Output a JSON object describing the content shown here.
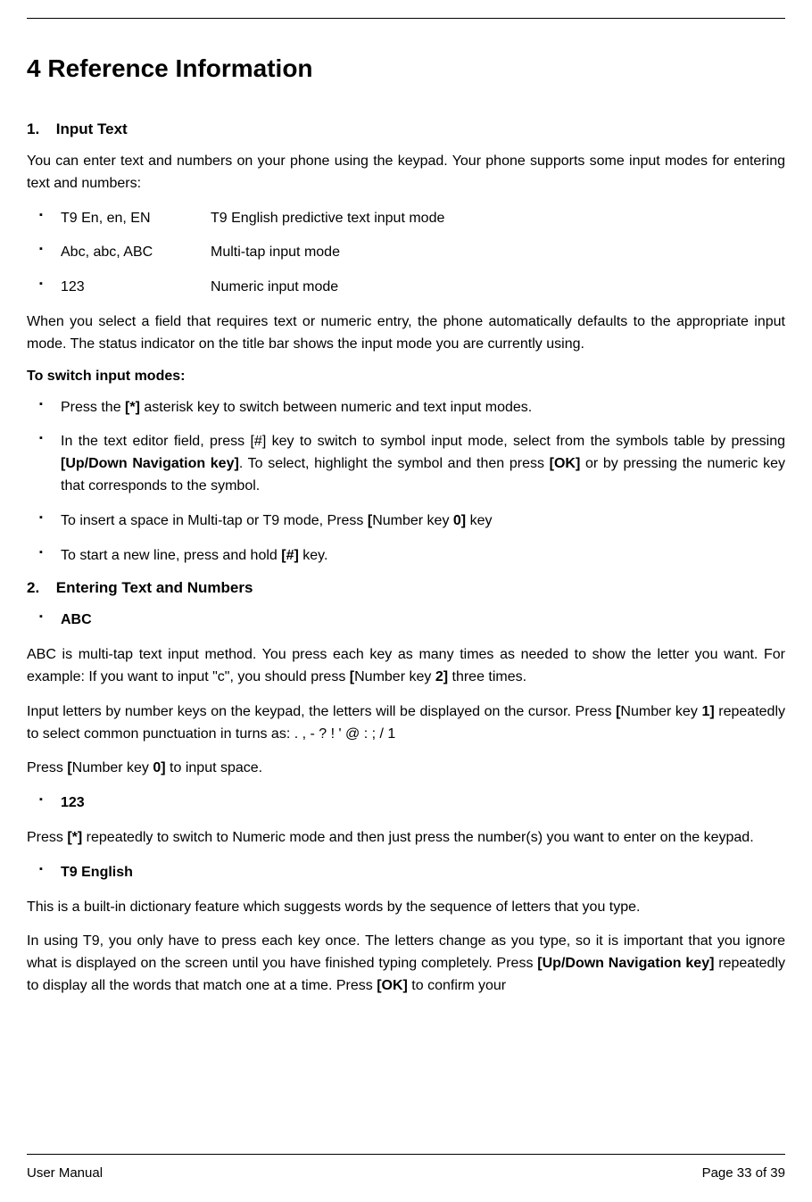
{
  "title": "4 Reference Information",
  "section1": {
    "num": "1.",
    "title": "Input Text",
    "intro": "You can enter text and numbers on your phone using the keypad. Your phone supports some input modes for entering text and numbers:",
    "modes": [
      {
        "name": "T9 En, en, EN",
        "desc": "T9 English predictive text input mode"
      },
      {
        "name": "Abc, abc, ABC",
        "desc": "Multi-tap input mode"
      },
      {
        "name": "123",
        "desc": "Numeric input mode"
      }
    ],
    "after_modes": "When you select a field that requires text or numeric entry, the phone automatically defaults to the appropriate input mode. The status indicator on the title bar shows the input mode you are currently using.",
    "switch_heading": "To switch input modes:",
    "switch": {
      "item1_a": "Press the ",
      "item1_b": "[*]",
      "item1_c": " asterisk key to switch between numeric and text input modes.",
      "item2_a": "In the text editor field, press [#] key to switch to symbol input mode, select from the symbols table by pressing ",
      "item2_b": "[Up/Down Navigation key]",
      "item2_c": ". To select, highlight the symbol and then press ",
      "item2_d": "[OK]",
      "item2_e": " or by pressing the numeric key that corresponds to the symbol.",
      "item3_a": "To insert a space in Multi-tap or T9 mode, Press ",
      "item3_b": "[",
      "item3_c": "Number key ",
      "item3_d": "0]",
      "item3_e": " key",
      "item4_a": "To start a new line, press and hold ",
      "item4_b": "[#]",
      "item4_c": " key."
    }
  },
  "section2": {
    "num": "2.",
    "title": "Entering Text and Numbers",
    "abc_label": "ABC",
    "abc_p1_a": "ABC is multi-tap text input method. You press each key as many times as needed to show the letter you want. For example: If you want to input \"c\", you should press ",
    "abc_p1_b": "[",
    "abc_p1_c": "Number key ",
    "abc_p1_d": "2]",
    "abc_p1_e": " three times.",
    "abc_p2_a": "Input letters by number keys on the keypad, the letters will be displayed on the cursor. Press ",
    "abc_p2_b": "[",
    "abc_p2_c": "Number key ",
    "abc_p2_d": "1]",
    "abc_p2_e": " repeatedly to select common punctuation in turns as: . , - ? ! ' @ : ; / 1",
    "abc_p3_a": "Press ",
    "abc_p3_b": "[",
    "abc_p3_c": "Number key ",
    "abc_p3_d": "0]",
    "abc_p3_e": " to input space.",
    "n123_label": "123",
    "n123_p_a": "Press ",
    "n123_p_b": "[*]",
    "n123_p_c": " repeatedly to switch to Numeric mode and then just press the number(s) you want to enter on the keypad.",
    "t9_label": "T9 English",
    "t9_p1": "This is a built-in dictionary feature which suggests words by the sequence of letters that you type.",
    "t9_p2_a": "In using T9, you only have to press each key once. The letters change as you type, so it is important that you ignore what is displayed on the screen until you have finished typing completely. Press ",
    "t9_p2_b": "[Up/Down Navigation key]",
    "t9_p2_c": " repeatedly to display all the words that match one at a time. Press ",
    "t9_p2_d": "[OK]",
    "t9_p2_e": " to confirm your"
  },
  "footer": {
    "left": "User Manual",
    "right": "Page 33 of 39"
  }
}
